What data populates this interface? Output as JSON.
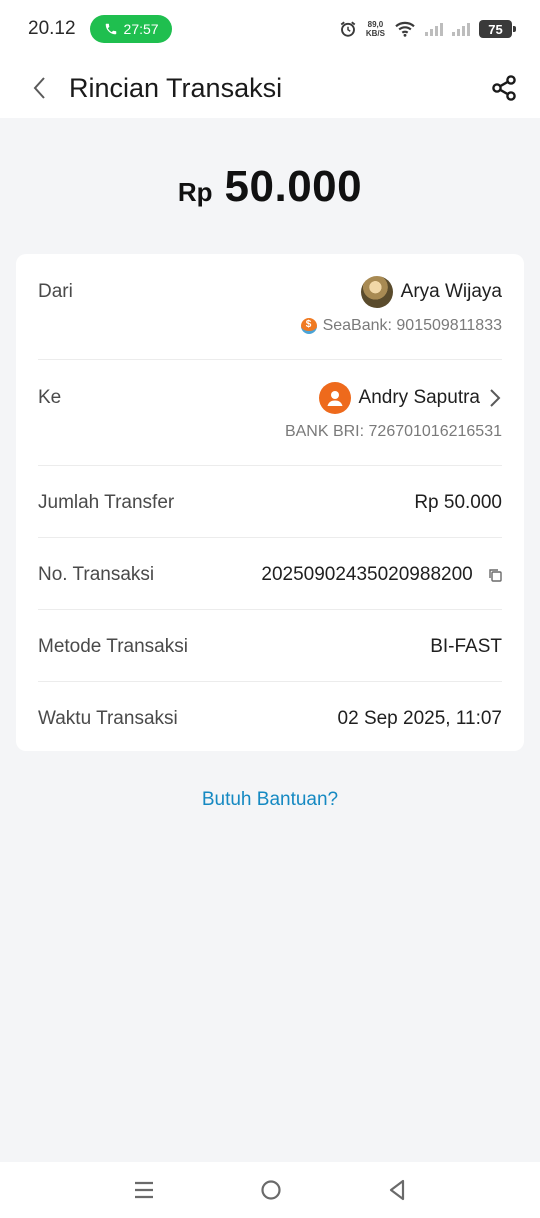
{
  "status_bar": {
    "time": "20.12",
    "call_duration": "27:57",
    "net_speed_value": "89,0",
    "net_speed_unit": "KB/S",
    "battery": "75"
  },
  "header": {
    "title": "Rincian Transaksi",
    "back_icon": "chevron-left-icon",
    "share_icon": "share-icon"
  },
  "amount": {
    "currency": "Rp",
    "value": "50.000"
  },
  "details": {
    "from": {
      "label": "Dari",
      "name": "Arya Wijaya",
      "account": "SeaBank: 901509811833"
    },
    "to": {
      "label": "Ke",
      "name": "Andry Saputra",
      "account": "BANK BRI: 726701016216531"
    },
    "transfer_amount": {
      "label": "Jumlah Transfer",
      "value": "Rp 50.000"
    },
    "transaction_no": {
      "label": "No. Transaksi",
      "value": "20250902435020988200"
    },
    "method": {
      "label": "Metode Transaksi",
      "value": "BI-FAST"
    },
    "time": {
      "label": "Waktu Transaksi",
      "value": "02 Sep 2025, 11:07"
    }
  },
  "help_link": "Butuh Bantuan?",
  "colors": {
    "accent_link": "#1589c2",
    "call_green": "#1fbf4f",
    "avatar_orange": "#ee6a1c",
    "background": "#f4f5f7"
  }
}
